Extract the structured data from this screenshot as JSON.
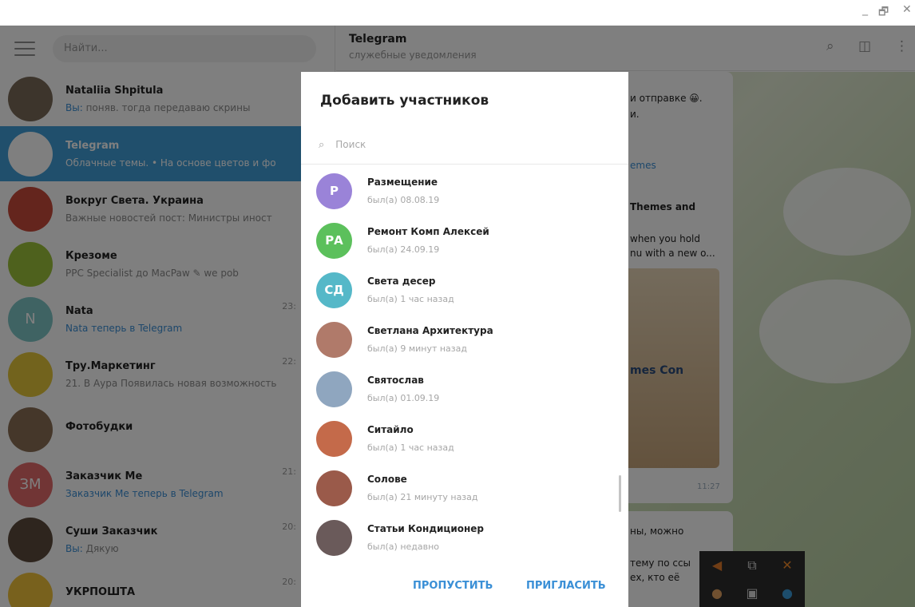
{
  "window": {
    "controls": [
      "_",
      "🗗",
      "✕"
    ]
  },
  "sidebar": {
    "search_placeholder": "Найти...",
    "chats": [
      {
        "name": "Nataliia Shpitula",
        "preview_prefix": "Вы:",
        "preview": " поняв. тогда передаваю скрины",
        "time": "",
        "avatar_color": "#7a6a58",
        "active": false
      },
      {
        "name": "Telegram",
        "preview_prefix": "",
        "preview": "Облачные темы. • На основе цветов и фо",
        "time": "",
        "avatar_color": "#ffffff",
        "active": true
      },
      {
        "name": "Вокруг Света. Украина",
        "preview_prefix": "",
        "preview": "Важные новостей пост: Министры иност",
        "time": "",
        "avatar_color": "#c84a3a",
        "active": false
      },
      {
        "name": "Крезоме",
        "preview_prefix": "",
        "preview": "PPC Specialist до MacPaw  ✎ we pob",
        "time": "",
        "avatar_color": "#9cc23a",
        "active": false
      },
      {
        "name": "Nata",
        "preview_prefix": "",
        "preview": "Nata теперь в Telegram",
        "time": "23:",
        "avatar_color": "#7fc7c7",
        "avatar_letter": "N",
        "active": false
      },
      {
        "name": "Тру.Маркетинг",
        "preview_prefix": "",
        "preview": "21. В Аура Появилась новая возможность",
        "time": "22:",
        "avatar_color": "#e5c63a",
        "active": false
      },
      {
        "name": "Фотобудки",
        "preview_prefix": "",
        "preview": "",
        "time": "",
        "avatar_color": "#8a6e55",
        "active": false
      },
      {
        "name": "Заказчик Me",
        "preview_prefix": "",
        "preview": "Заказчик Me теперь в Telegram",
        "time": "21:",
        "avatar_color": "#e26a6a",
        "avatar_letter": "ЗМ",
        "active": false
      },
      {
        "name": "Суши Заказчик",
        "preview_prefix": "Вы:",
        "preview": " Дякую",
        "time": "20:",
        "avatar_color": "#5c4b3c",
        "active": false
      },
      {
        "name": "УКРПОШТА",
        "preview_prefix": "",
        "preview": "",
        "time": "20:",
        "avatar_color": "#f0c23a",
        "active": false
      }
    ]
  },
  "chat_header": {
    "title": "Telegram",
    "subtitle": "служебные уведомления"
  },
  "chat_snippets": {
    "line1": "и отправке 😀.",
    "line2": "и.",
    "link": "emes",
    "themes": "Themes and",
    "hold1": "when you hold",
    "hold2": "nu with a new o...",
    "sticker": "mes Con",
    "time": "11:27",
    "bottom1": "ны, можно",
    "bottom2": "тему по ссы",
    "bottom3": "ех, кто её"
  },
  "modal": {
    "title": "Добавить участников",
    "search_placeholder": "Поиск",
    "contacts": [
      {
        "name": "Размещение",
        "status": "был(а) 08.08.19",
        "initials": "Р",
        "color": "#9a83d8"
      },
      {
        "name": "Ремонт Комп Алексей",
        "status": "был(а) 24.09.19",
        "initials": "РА",
        "color": "#5cc05c"
      },
      {
        "name": "Света десер",
        "status": "был(а) 1 час назад",
        "initials": "СД",
        "color": "#55b8c8"
      },
      {
        "name": "Светлана Архитектура",
        "status": "был(а) 9 минут назад",
        "initials": "",
        "color": "#b07a6a"
      },
      {
        "name": "Святослав",
        "status": "был(а) 01.09.19",
        "initials": "",
        "color": "#8fa6bf"
      },
      {
        "name": "Ситайло",
        "status": "был(а) 1 час назад",
        "initials": "",
        "color": "#c46a4a"
      },
      {
        "name": "Солове",
        "status": "был(а) 21 минуту назад",
        "initials": "",
        "color": "#9a5a4a"
      },
      {
        "name": "Статьи Кондиционер",
        "status": "был(а) недавно",
        "initials": "",
        "color": "#6a5a5a"
      }
    ],
    "skip_label": "ПРОПУСТИТЬ",
    "invite_label": "ПРИГЛАСИТЬ"
  },
  "colors": {
    "accent": "#419fd9",
    "link": "#3a8fd6"
  }
}
